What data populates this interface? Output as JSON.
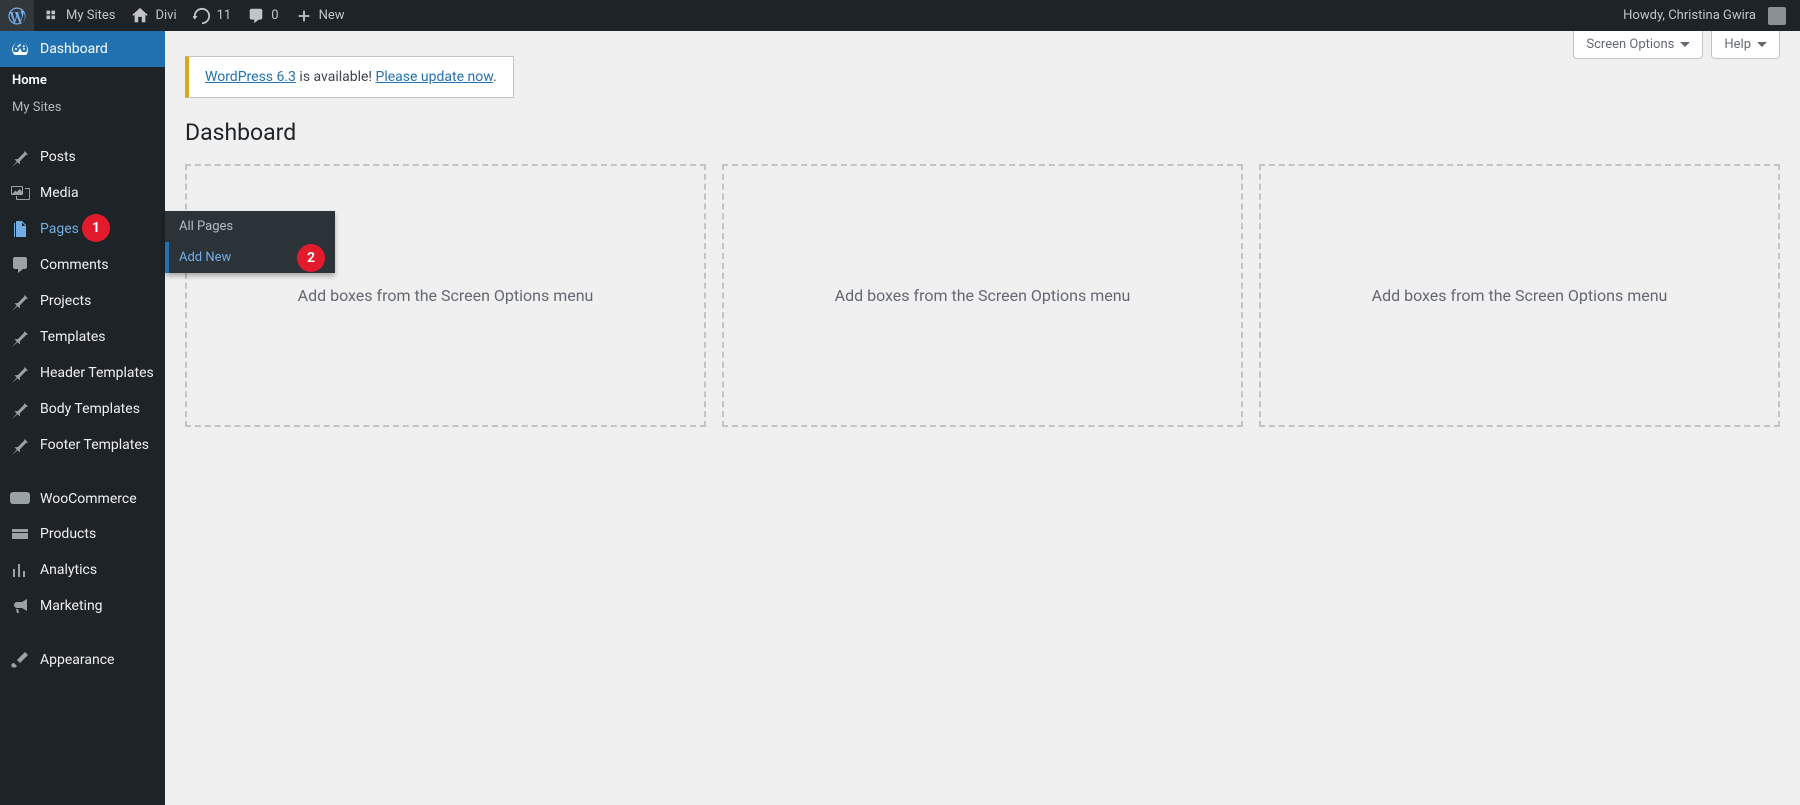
{
  "adminbar": {
    "mysites": "My Sites",
    "site_name": "Divi",
    "updates": "11",
    "comments": "0",
    "new": "New",
    "howdy": "Howdy, Christina Gwira"
  },
  "menu": {
    "dashboard": "Dashboard",
    "dashboard_sub": {
      "home": "Home",
      "mysites": "My Sites"
    },
    "posts": "Posts",
    "media": "Media",
    "pages": "Pages",
    "pages_flyout": {
      "all": "All Pages",
      "add_new": "Add New"
    },
    "comments": "Comments",
    "projects": "Projects",
    "templates": "Templates",
    "header_templates": "Header Templates",
    "body_templates": "Body Templates",
    "footer_templates": "Footer Templates",
    "woocommerce": "WooCommerce",
    "products": "Products",
    "analytics": "Analytics",
    "marketing": "Marketing",
    "appearance": "Appearance"
  },
  "badges": {
    "one": "1",
    "two": "2"
  },
  "main": {
    "screen_options": "Screen Options",
    "help": "Help",
    "update_link1": "WordPress 6.3",
    "update_mid": " is available! ",
    "update_link2": "Please update now",
    "update_end": ".",
    "title": "Dashboard",
    "empty_box": "Add boxes from the Screen Options menu",
    "empty_box_partial": "from the Screen Options menu"
  }
}
